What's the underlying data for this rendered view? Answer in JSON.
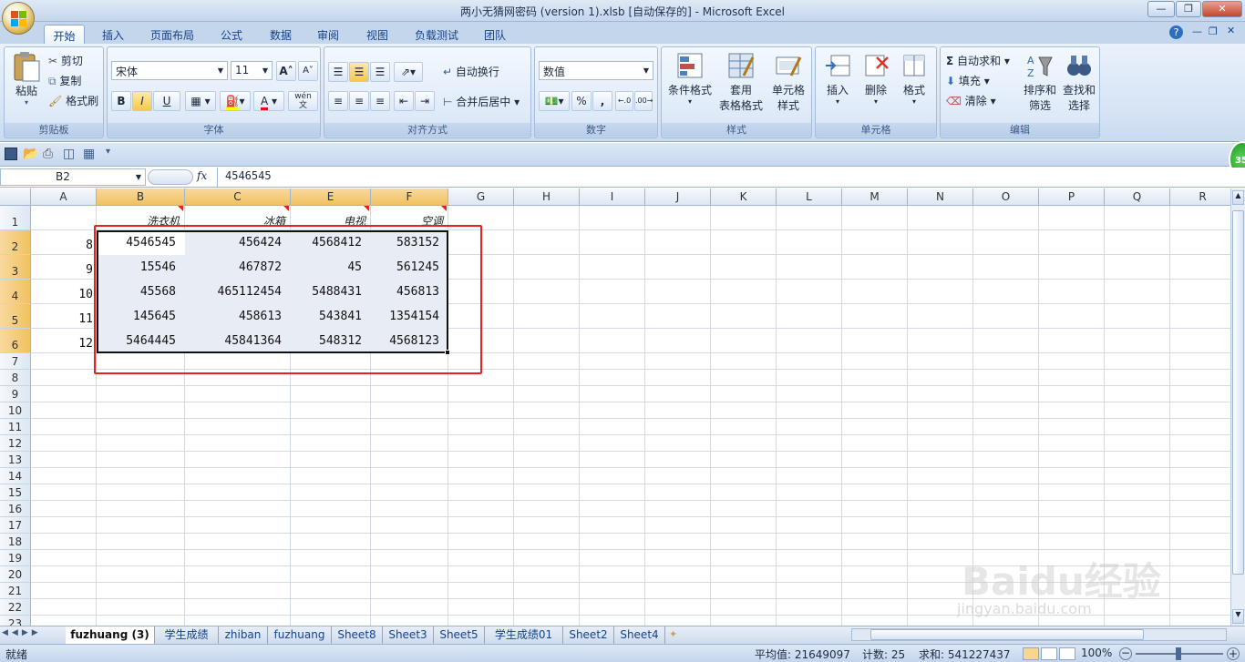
{
  "window": {
    "title": "两小无猜网密码 (version 1).xlsb [自动保存的] - Microsoft Excel"
  },
  "tabs": [
    "开始",
    "插入",
    "页面布局",
    "公式",
    "数据",
    "审阅",
    "视图",
    "负载测试",
    "团队"
  ],
  "ribbon": {
    "clipboard": {
      "label": "剪贴板",
      "paste": "粘贴",
      "cut": "剪切",
      "copy": "复制",
      "format_painter": "格式刷"
    },
    "font": {
      "label": "字体",
      "font_name": "宋体",
      "font_size": "11",
      "bold": "B",
      "italic": "I",
      "underline": "U",
      "grow": "A",
      "shrink": "A",
      "font_color": "A",
      "phonetic": "wén"
    },
    "alignment": {
      "label": "对齐方式",
      "wrap": "自动换行",
      "merge": "合并后居中"
    },
    "number": {
      "label": "数字",
      "format": "数值",
      "percent": "%",
      "comma": ","
    },
    "styles": {
      "label": "样式",
      "conditional": "条件格式",
      "table_fmt_1": "套用",
      "table_fmt_2": "表格格式",
      "cell_style_1": "单元格",
      "cell_style_2": "样式"
    },
    "cells": {
      "label": "单元格",
      "insert": "插入",
      "delete": "删除",
      "format": "格式"
    },
    "editing": {
      "label": "编辑",
      "autosum": "自动求和",
      "fill": "填充",
      "clear": "清除",
      "sort_1": "排序和",
      "sort_2": "筛选",
      "find_1": "查找和",
      "find_2": "选择"
    }
  },
  "badge": "35",
  "formula_bar": {
    "name_box": "B2",
    "fx": "fx",
    "value": "4546545"
  },
  "columns": [
    "A",
    "B",
    "C",
    "E",
    "F",
    "G",
    "H",
    "I",
    "J",
    "K",
    "L",
    "M",
    "N",
    "O",
    "P",
    "Q",
    "R"
  ],
  "rows": [
    "1",
    "2",
    "3",
    "4",
    "5",
    "6",
    "7",
    "8",
    "9",
    "10",
    "11",
    "12",
    "13",
    "14",
    "15",
    "16",
    "17",
    "18",
    "19",
    "20",
    "21",
    "22",
    "23"
  ],
  "headers": {
    "B": "洗衣机",
    "C": "冰箱",
    "E": "电视",
    "F": "空调"
  },
  "col_a": [
    "8",
    "9",
    "10",
    "11",
    "12"
  ],
  "data_rows": [
    [
      "4546545",
      "456424",
      "4568412",
      "583152"
    ],
    [
      "15546",
      "467872",
      "45",
      "561245"
    ],
    [
      "45568",
      "465112454",
      "5488431",
      "456813"
    ],
    [
      "145645",
      "458613",
      "543841",
      "1354154"
    ],
    [
      "5464445",
      "45841364",
      "548312",
      "4568123"
    ]
  ],
  "sheets": [
    "fuzhuang (3)",
    "学生成绩",
    "zhiban",
    "fuzhuang",
    "Sheet8",
    "Sheet3",
    "Sheet5",
    "学生成绩01",
    "Sheet2",
    "Sheet4"
  ],
  "status": {
    "ready": "就绪",
    "average": "平均值: 21649097",
    "count": "计数: 25",
    "sum": "求和: 541227437",
    "zoom": "100%"
  },
  "watermark": {
    "brand": "Baidu经验",
    "url": "jingyan.baidu.com"
  },
  "colors": {
    "accent": "#15428b",
    "selection_frame": "#e52222",
    "header_selected": "#f1c15f"
  }
}
